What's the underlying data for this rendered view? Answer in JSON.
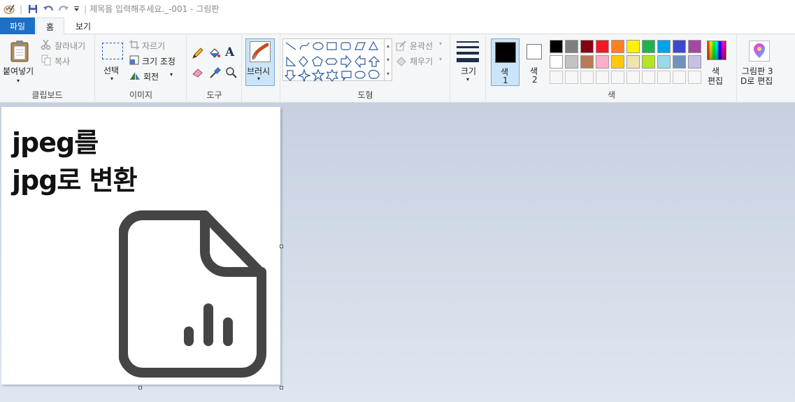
{
  "titlebar": {
    "title": "제목을 입력해주세요._-001 - 그림판",
    "separator": "|",
    "icons": [
      "paint-app-icon",
      "save-icon",
      "undo-icon",
      "redo-icon",
      "customize-qat-icon"
    ]
  },
  "tabs": {
    "file": "파일",
    "home": "홈",
    "view": "보기"
  },
  "ribbon": {
    "clipboard": {
      "label": "클립보드",
      "paste": "붙여넣기",
      "cut": "잘라내기",
      "copy": "복사"
    },
    "image": {
      "label": "이미지",
      "select": "선택",
      "crop": "자르기",
      "resize": "크기 조정",
      "rotate": "회전"
    },
    "tools": {
      "label": "도구"
    },
    "brushes": {
      "label": "브러시"
    },
    "shapes": {
      "label": "도형",
      "outline": "윤곽선",
      "fill": "채우기"
    },
    "size": {
      "label": "크기"
    },
    "colors": {
      "label": "색",
      "color1": "색",
      "color1_num": "1",
      "color2": "색",
      "color2_num": "2",
      "edit_line1": "색",
      "edit_line2": "편집",
      "color1_value": "#000000",
      "color2_value": "#ffffff",
      "palette_row1": [
        "#000000",
        "#7f7f7f",
        "#880015",
        "#ed1c24",
        "#ff7f27",
        "#fff200",
        "#22b14c",
        "#00a2e8",
        "#3f48cc",
        "#a349a4"
      ],
      "palette_row2": [
        "#ffffff",
        "#c3c3c3",
        "#b97a57",
        "#ffaec9",
        "#ffc90e",
        "#efe4b0",
        "#b5e61d",
        "#99d9ea",
        "#7092be",
        "#c8bfe7"
      ]
    },
    "paint3d": {
      "line1": "그림판 3",
      "line2": "D로 편집"
    }
  },
  "canvas": {
    "heading_line1": "jpeg를",
    "heading_line2": "jpg로 변환",
    "icon": "file-chart-icon"
  }
}
